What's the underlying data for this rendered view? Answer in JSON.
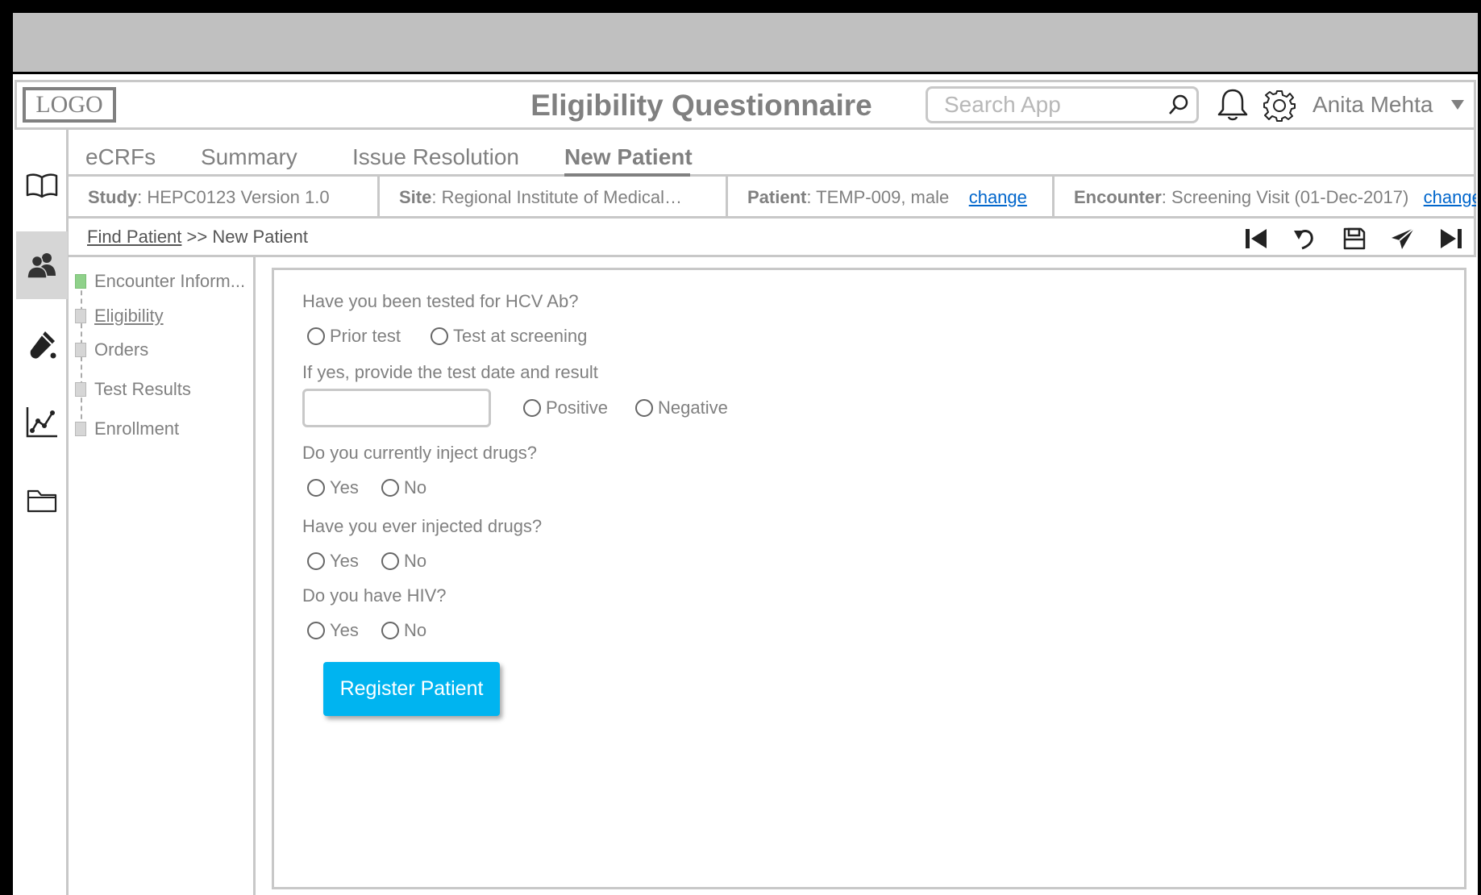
{
  "header": {
    "logo": "LOGO",
    "title": "Eligibility Questionnaire",
    "search_placeholder": "Search App",
    "user_name": "Anita Mehta"
  },
  "rail": {
    "icons": [
      "book-icon",
      "users-icon",
      "test-tube-icon",
      "chart-icon",
      "folder-icon"
    ],
    "active": "users-icon"
  },
  "tabs": [
    {
      "label": "eCRFs"
    },
    {
      "label": "Summary"
    },
    {
      "label": "Issue Resolution"
    },
    {
      "label": "New Patient",
      "active": true
    }
  ],
  "info": {
    "study_label": "Study",
    "study_value": ": HEPC0123 Version 1.0",
    "site_label": "Site",
    "site_value": ": Regional Institute of Medical…",
    "patient_label": "Patient",
    "patient_value": ": TEMP-009, male",
    "patient_change": "change",
    "encounter_label": "Encounter",
    "encounter_value": ": Screening Visit (01-Dec-2017)",
    "encounter_change": "change"
  },
  "breadcrumb": {
    "link": "Find Patient",
    "separator": " >> ",
    "current": "New Patient"
  },
  "toolbar": {
    "icons": [
      "first-icon",
      "undo-icon",
      "save-icon",
      "send-icon",
      "last-icon"
    ]
  },
  "steps": [
    {
      "label": "Encounter Inform...",
      "done": true
    },
    {
      "label": "Eligibility",
      "current": true
    },
    {
      "label": "Orders"
    },
    {
      "label": "Test Results"
    },
    {
      "label": "Enrollment"
    }
  ],
  "form": {
    "q1": "Have you been tested for HCV Ab?",
    "q1_opt1": "Prior test",
    "q1_opt2": "Test at screening",
    "q2": "If yes, provide the test date and result",
    "q2_opt1": "Positive",
    "q2_opt2": "Negative",
    "q3": "Do you currently inject drugs?",
    "q3_opt1": "Yes",
    "q3_opt2": "No",
    "q4": "Have you ever injected drugs?",
    "q4_opt1": "Yes",
    "q4_opt2": "No",
    "q5": "Do you have HIV?",
    "q5_opt1": "Yes",
    "q5_opt2": "No",
    "submit_label": "Register Patient"
  },
  "colors": {
    "accent": "#00b4f0",
    "link": "#0066cc",
    "step_done": "#8fd18a"
  }
}
